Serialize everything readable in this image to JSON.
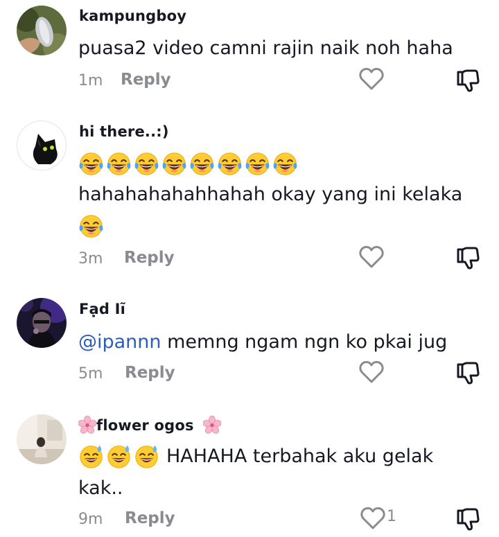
{
  "comments": [
    {
      "username": "kampungboy",
      "text": "puasa2 video camni rajin naik noh haha",
      "time": "1m",
      "reply_label": "Reply",
      "likes": "",
      "avatar_icon": "fish-photo-avatar"
    },
    {
      "username": "hi there..:)",
      "emoji_line": [
        "laughing-tears-emoji",
        "laughing-tears-emoji",
        "laughing-tears-emoji",
        "laughing-tears-emoji",
        "laughing-tears-emoji",
        "laughing-tears-emoji",
        "laughing-tears-emoji",
        "laughing-tears-emoji"
      ],
      "text": "hahahahahahhahah okay yang ini kelaka",
      "trailing_emoji": "laughing-tears-emoji",
      "time": "3m",
      "reply_label": "Reply",
      "likes": "",
      "avatar_icon": "black-cat-avatar"
    },
    {
      "username": "Fạd Iĩ",
      "mention": "@ipannn",
      "text": " memng ngam ngn ko pkai jug",
      "time": "5m",
      "reply_label": "Reply",
      "likes": "",
      "avatar_icon": "person-photo-avatar"
    },
    {
      "username": "flower ogos",
      "username_emoji": "cherry-blossom-emoji",
      "text_line1": "HAHAHA terbahak aku gelak",
      "text_line2": "kak..",
      "leading_emojis": [
        "sweat-smile-emoji",
        "sweat-smile-emoji",
        "sweat-smile-emoji"
      ],
      "time": "9m",
      "reply_label": "Reply",
      "likes": "1",
      "avatar_icon": "room-photo-avatar"
    }
  ],
  "colors": {
    "text": "#161823",
    "meta": "#8a8b91",
    "mention": "#2b5db9"
  }
}
